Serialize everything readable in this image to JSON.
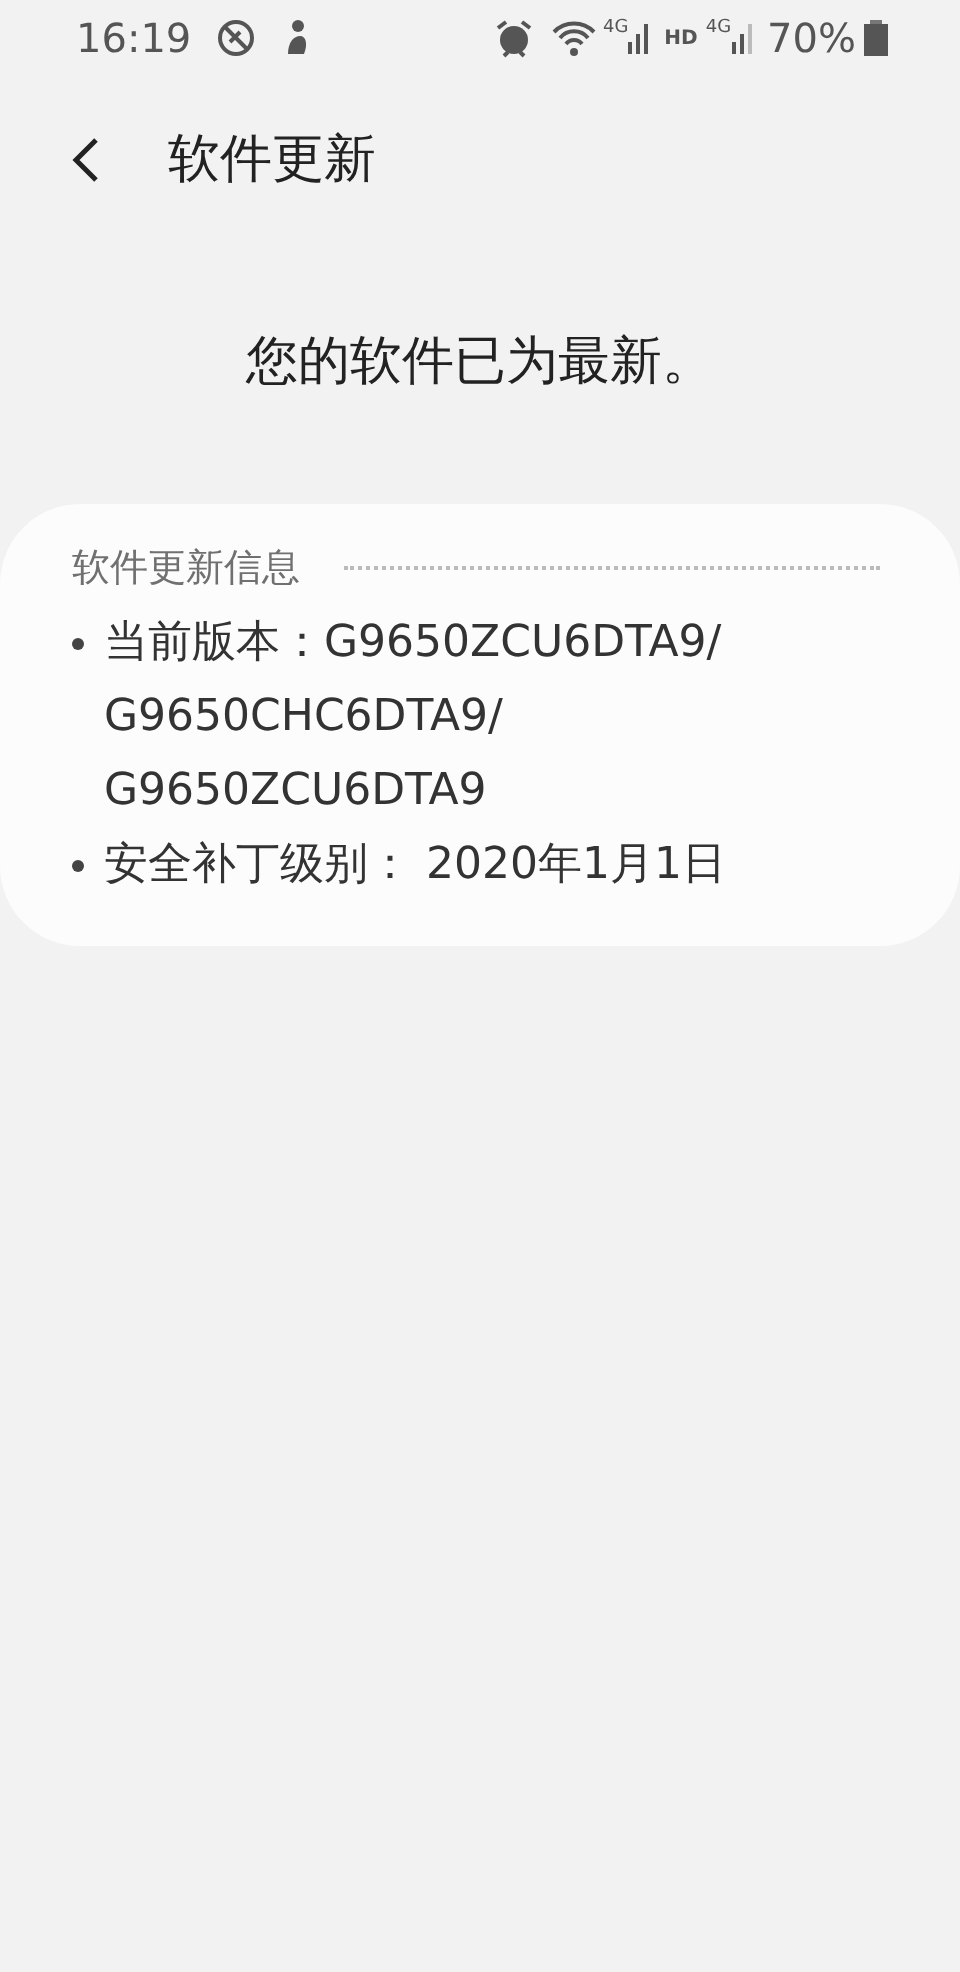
{
  "status_bar": {
    "time": "16:19",
    "network_labels": [
      "4G",
      "HD",
      "4G"
    ],
    "battery": "70%"
  },
  "header": {
    "title": "软件更新"
  },
  "message": "您的软件已为最新。",
  "info_card": {
    "title": "软件更新信息",
    "items": [
      {
        "lines": [
          "当前版本：G9650ZCU6DTA9/",
          "G9650CHC6DTA9/",
          "G9650ZCU6DTA9"
        ]
      },
      {
        "lines": [
          "安全补丁级别： 2020年1月1日"
        ]
      }
    ]
  }
}
